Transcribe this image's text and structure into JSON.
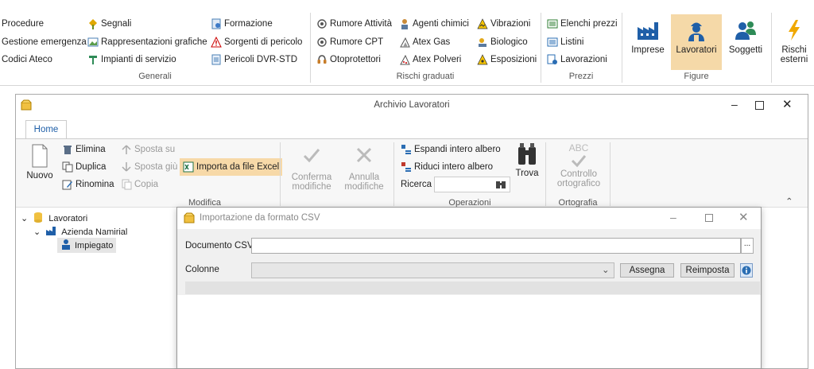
{
  "ribbon": {
    "generali": {
      "col1": [
        "Procedure",
        "Gestione emergenza",
        "Codici Ateco"
      ],
      "col2": [
        "Segnali",
        "Rappresentazioni grafiche",
        "Impianti di servizio"
      ],
      "col3": [
        "Formazione",
        "Sorgenti di pericolo",
        "Pericoli DVR-STD"
      ],
      "label": "Generali"
    },
    "rischi": {
      "col1": [
        "Rumore Attività",
        "Rumore CPT",
        "Otoprotettori"
      ],
      "col2": [
        "Agenti chimici",
        "Atex Gas",
        "Atex Polveri"
      ],
      "col3": [
        "Vibrazioni",
        "Biologico",
        "Esposizioni"
      ],
      "label": "Rischi graduati"
    },
    "prezzi": {
      "items": [
        "Elenchi prezzi",
        "Listini",
        "Lavorazioni"
      ],
      "label": "Prezzi"
    },
    "figure": {
      "imprese": "Imprese",
      "lavoratori": "Lavoratori",
      "soggetti": "Soggetti",
      "label": "Figure"
    },
    "rischi_esterni": [
      "Rischi",
      "esterni"
    ]
  },
  "window": {
    "title": "Archivio Lavoratori",
    "tab_home": "Home",
    "nuovo": "Nuovo",
    "elimina": "Elimina",
    "duplica": "Duplica",
    "rinomina": "Rinomina",
    "sposta_su": "Sposta su",
    "sposta_giu": "Sposta giù",
    "copia": "Copia",
    "importa": "Importa da file Excel",
    "conferma": [
      "Conferma",
      "modifiche"
    ],
    "annulla": [
      "Annulla",
      "modifiche"
    ],
    "modifica_label": "Modifica",
    "espandi": "Espandi intero albero",
    "riduci": "Riduci intero albero",
    "ricerca": "Ricerca",
    "trova": "Trova",
    "operazioni_label": "Operazioni",
    "controllo": [
      "Controllo",
      "ortografico"
    ],
    "abc": "ABC",
    "ortografia_label": "Ortografia"
  },
  "tree": {
    "root": "Lavoratori",
    "company": "Azienda Namirial",
    "leaf": "Impiegato"
  },
  "dialog": {
    "title": "Importazione da formato CSV",
    "doc_label": "Documento CSV",
    "doc_value": "",
    "browse": "...",
    "colonne_label": "Colonne",
    "assegna": "Assegna",
    "reimposta": "Reimposta"
  },
  "colors": {
    "accent_orange": "#f7d9a8",
    "figure_selected": "#f5d9a8",
    "ribbon_blue": "#1f5fa8"
  }
}
